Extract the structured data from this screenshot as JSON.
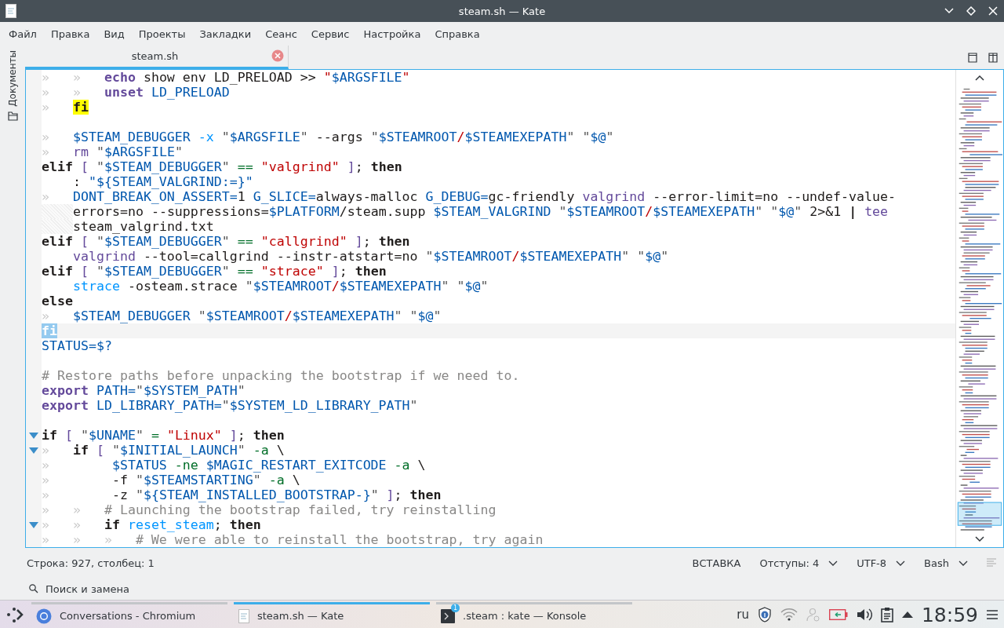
{
  "window": {
    "title": "steam.sh — Kate"
  },
  "menu": [
    "Файл",
    "Правка",
    "Вид",
    "Проекты",
    "Закладки",
    "Сеанс",
    "Сервис",
    "Настройка",
    "Справка"
  ],
  "sidebar": {
    "label": "Документы"
  },
  "tabs": [
    {
      "label": "steam.sh",
      "selected": true
    }
  ],
  "editor": {
    "lines": [
      {
        "kind": "code",
        "tokens": [
          {
            "kind": "ws",
            "text": "»   »   "
          },
          {
            "kind": "bi",
            "text": "echo"
          },
          {
            "kind": "plain",
            "text": " show env LD_PRELOAD >> "
          },
          {
            "kind": "str",
            "text": "\""
          },
          {
            "kind": "var",
            "text": "$ARGSFILE"
          },
          {
            "kind": "str",
            "text": "\""
          }
        ]
      },
      {
        "kind": "code",
        "tokens": [
          {
            "kind": "ws",
            "text": "»   »   "
          },
          {
            "kind": "bi",
            "text": "unset "
          },
          {
            "kind": "var",
            "text": "LD_PRELOAD"
          }
        ]
      },
      {
        "kind": "code",
        "tokens": [
          {
            "kind": "ws",
            "text": "»   "
          },
          {
            "kind": "match",
            "text": "fi"
          }
        ]
      },
      {
        "kind": "blank"
      },
      {
        "kind": "code",
        "tokens": [
          {
            "kind": "ws",
            "text": "»   "
          },
          {
            "kind": "var",
            "text": "$STEAM_DEBUGGER "
          },
          {
            "kind": "opt",
            "text": "-x "
          },
          {
            "kind": "q",
            "text": "\""
          },
          {
            "kind": "var",
            "text": "$ARGSFILE"
          },
          {
            "kind": "q",
            "text": "\""
          },
          {
            "kind": "plain",
            "text": " --args "
          },
          {
            "kind": "q",
            "text": "\""
          },
          {
            "kind": "var",
            "text": "$STEAMROOT"
          },
          {
            "kind": "sl",
            "text": "/"
          },
          {
            "kind": "var",
            "text": "$STEAMEXEPATH"
          },
          {
            "kind": "q",
            "text": "\" \""
          },
          {
            "kind": "var",
            "text": "$@"
          },
          {
            "kind": "q",
            "text": "\""
          }
        ]
      },
      {
        "kind": "code",
        "tokens": [
          {
            "kind": "ws",
            "text": "»   "
          },
          {
            "kind": "cmd",
            "text": "rm "
          },
          {
            "kind": "q",
            "text": "\""
          },
          {
            "kind": "var",
            "text": "$ARGSFILE"
          },
          {
            "kind": "q",
            "text": "\""
          }
        ]
      },
      {
        "kind": "code",
        "tokens": [
          {
            "kind": "kw",
            "text": "elif "
          },
          {
            "kind": "br",
            "text": "[ "
          },
          {
            "kind": "q",
            "text": "\""
          },
          {
            "kind": "var",
            "text": "$STEAM_DEBUGGER"
          },
          {
            "kind": "q",
            "text": "\" "
          },
          {
            "kind": "op",
            "text": "== "
          },
          {
            "kind": "str",
            "text": "\"valgrind\" "
          },
          {
            "kind": "br",
            "text": "]"
          },
          {
            "kind": "plain",
            "text": "; "
          },
          {
            "kind": "kw",
            "text": "then"
          }
        ]
      },
      {
        "kind": "code",
        "tokens": [
          {
            "kind": "plain",
            "text": "    : "
          },
          {
            "kind": "var",
            "text": "\"${STEAM_VALGRIND:=}\""
          }
        ]
      },
      {
        "kind": "code",
        "tokens": [
          {
            "kind": "ws",
            "text": "»   "
          },
          {
            "kind": "var",
            "text": "DONT_BREAK_ON_ASSERT="
          },
          {
            "kind": "plain",
            "text": "1 "
          },
          {
            "kind": "var",
            "text": "G_SLICE="
          },
          {
            "kind": "plain",
            "text": "always-malloc "
          },
          {
            "kind": "var",
            "text": "G_DEBUG="
          },
          {
            "kind": "plain",
            "text": "gc-friendly "
          },
          {
            "kind": "cmd",
            "text": "valgrind"
          },
          {
            "kind": "plain",
            "text": " --error-limit=no --undef-value-"
          }
        ]
      },
      {
        "kind": "wrapped",
        "tokens": [
          {
            "kind": "plain",
            "text": "errors=no --suppressions="
          },
          {
            "kind": "var",
            "text": "$PLATFORM"
          },
          {
            "kind": "plain",
            "text": "/steam.supp "
          },
          {
            "kind": "var",
            "text": "$STEAM_VALGRIND "
          },
          {
            "kind": "q",
            "text": "\""
          },
          {
            "kind": "var",
            "text": "$STEAMROOT"
          },
          {
            "kind": "sl",
            "text": "/"
          },
          {
            "kind": "var",
            "text": "$STEAMEXEPATH"
          },
          {
            "kind": "q",
            "text": "\" \""
          },
          {
            "kind": "var",
            "text": "$@"
          },
          {
            "kind": "q",
            "text": "\""
          },
          {
            "kind": "plain",
            "text": " 2>&1 "
          },
          {
            "kind": "kw",
            "text": "| "
          },
          {
            "kind": "cmd",
            "text": "tee"
          }
        ]
      },
      {
        "kind": "wrapped",
        "tokens": [
          {
            "kind": "plain",
            "text": "steam_valgrind.txt"
          }
        ]
      },
      {
        "kind": "code",
        "tokens": [
          {
            "kind": "kw",
            "text": "elif "
          },
          {
            "kind": "br",
            "text": "[ "
          },
          {
            "kind": "q",
            "text": "\""
          },
          {
            "kind": "var",
            "text": "$STEAM_DEBUGGER"
          },
          {
            "kind": "q",
            "text": "\" "
          },
          {
            "kind": "op",
            "text": "== "
          },
          {
            "kind": "str",
            "text": "\"callgrind\" "
          },
          {
            "kind": "br",
            "text": "]"
          },
          {
            "kind": "plain",
            "text": "; "
          },
          {
            "kind": "kw",
            "text": "then"
          }
        ]
      },
      {
        "kind": "code",
        "tokens": [
          {
            "kind": "cmd",
            "text": "    valgrind"
          },
          {
            "kind": "plain",
            "text": " --tool=callgrind --instr-atstart=no "
          },
          {
            "kind": "q",
            "text": "\""
          },
          {
            "kind": "var",
            "text": "$STEAMROOT"
          },
          {
            "kind": "sl",
            "text": "/"
          },
          {
            "kind": "var",
            "text": "$STEAMEXEPATH"
          },
          {
            "kind": "q",
            "text": "\" \""
          },
          {
            "kind": "var",
            "text": "$@"
          },
          {
            "kind": "q",
            "text": "\""
          }
        ]
      },
      {
        "kind": "code",
        "tokens": [
          {
            "kind": "kw",
            "text": "elif "
          },
          {
            "kind": "br",
            "text": "[ "
          },
          {
            "kind": "q",
            "text": "\""
          },
          {
            "kind": "var",
            "text": "$STEAM_DEBUGGER"
          },
          {
            "kind": "q",
            "text": "\" "
          },
          {
            "kind": "op",
            "text": "== "
          },
          {
            "kind": "str",
            "text": "\"strace\" "
          },
          {
            "kind": "br",
            "text": "]"
          },
          {
            "kind": "plain",
            "text": "; "
          },
          {
            "kind": "kw",
            "text": "then"
          }
        ]
      },
      {
        "kind": "code",
        "tokens": [
          {
            "kind": "opt",
            "text": "    strace"
          },
          {
            "kind": "plain",
            "text": " -osteam.strace "
          },
          {
            "kind": "q",
            "text": "\""
          },
          {
            "kind": "var",
            "text": "$STEAMROOT"
          },
          {
            "kind": "sl",
            "text": "/"
          },
          {
            "kind": "var",
            "text": "$STEAMEXEPATH"
          },
          {
            "kind": "q",
            "text": "\" \""
          },
          {
            "kind": "var",
            "text": "$@"
          },
          {
            "kind": "q",
            "text": "\""
          }
        ]
      },
      {
        "kind": "code",
        "tokens": [
          {
            "kind": "kw",
            "text": "else"
          }
        ]
      },
      {
        "kind": "code",
        "tokens": [
          {
            "kind": "ws",
            "text": "»   "
          },
          {
            "kind": "var",
            "text": "$STEAM_DEBUGGER "
          },
          {
            "kind": "q",
            "text": "\""
          },
          {
            "kind": "var",
            "text": "$STEAMROOT"
          },
          {
            "kind": "sl",
            "text": "/"
          },
          {
            "kind": "var",
            "text": "$STEAMEXEPATH"
          },
          {
            "kind": "q",
            "text": "\" \""
          },
          {
            "kind": "var",
            "text": "$@"
          },
          {
            "kind": "q",
            "text": "\""
          }
        ]
      },
      {
        "kind": "current",
        "tokens": [
          {
            "kind": "sel",
            "text": "fi"
          }
        ]
      },
      {
        "kind": "code",
        "tokens": [
          {
            "kind": "var",
            "text": "STATUS=$?"
          }
        ]
      },
      {
        "kind": "blank"
      },
      {
        "kind": "code",
        "tokens": [
          {
            "kind": "cmt",
            "text": "# Restore paths before unpacking the bootstrap if we need to."
          }
        ]
      },
      {
        "kind": "code",
        "tokens": [
          {
            "kind": "bi",
            "text": "export "
          },
          {
            "kind": "var",
            "text": "PATH="
          },
          {
            "kind": "q",
            "text": "\""
          },
          {
            "kind": "var",
            "text": "$SYSTEM_PATH"
          },
          {
            "kind": "q",
            "text": "\""
          }
        ]
      },
      {
        "kind": "code",
        "tokens": [
          {
            "kind": "bi",
            "text": "export "
          },
          {
            "kind": "var",
            "text": "LD_LIBRARY_PATH="
          },
          {
            "kind": "q",
            "text": "\""
          },
          {
            "kind": "var",
            "text": "$SYSTEM_LD_LIBRARY_PATH"
          },
          {
            "kind": "q",
            "text": "\""
          }
        ]
      },
      {
        "kind": "blank"
      },
      {
        "kind": "fold",
        "tokens": [
          {
            "kind": "kw",
            "text": "if "
          },
          {
            "kind": "br",
            "text": "[ "
          },
          {
            "kind": "q",
            "text": "\""
          },
          {
            "kind": "var",
            "text": "$UNAME"
          },
          {
            "kind": "q",
            "text": "\" "
          },
          {
            "kind": "op",
            "text": "= "
          },
          {
            "kind": "str",
            "text": "\"Linux\" "
          },
          {
            "kind": "br",
            "text": "]"
          },
          {
            "kind": "plain",
            "text": "; "
          },
          {
            "kind": "kw",
            "text": "then"
          }
        ]
      },
      {
        "kind": "fold",
        "tokens": [
          {
            "kind": "ws",
            "text": "»   "
          },
          {
            "kind": "kw",
            "text": "if "
          },
          {
            "kind": "br",
            "text": "[ "
          },
          {
            "kind": "q",
            "text": "\""
          },
          {
            "kind": "var",
            "text": "$INITIAL_LAUNCH"
          },
          {
            "kind": "q",
            "text": "\" "
          },
          {
            "kind": "op",
            "text": "-a"
          },
          {
            "kind": "plain",
            "text": " \\"
          }
        ]
      },
      {
        "kind": "code",
        "tokens": [
          {
            "kind": "ws",
            "text": "»        "
          },
          {
            "kind": "var",
            "text": "$STATUS "
          },
          {
            "kind": "op",
            "text": "-ne "
          },
          {
            "kind": "var",
            "text": "$MAGIC_RESTART_EXITCODE "
          },
          {
            "kind": "op",
            "text": "-a"
          },
          {
            "kind": "plain",
            "text": " \\"
          }
        ]
      },
      {
        "kind": "code",
        "tokens": [
          {
            "kind": "ws",
            "text": "»        "
          },
          {
            "kind": "plain",
            "text": "-f "
          },
          {
            "kind": "q",
            "text": "\""
          },
          {
            "kind": "var",
            "text": "$STEAMSTARTING"
          },
          {
            "kind": "q",
            "text": "\" "
          },
          {
            "kind": "op",
            "text": "-a"
          },
          {
            "kind": "plain",
            "text": " \\"
          }
        ]
      },
      {
        "kind": "code",
        "tokens": [
          {
            "kind": "ws",
            "text": "»        "
          },
          {
            "kind": "plain",
            "text": "-z "
          },
          {
            "kind": "q",
            "text": "\""
          },
          {
            "kind": "var",
            "text": "${STEAM_INSTALLED_BOOTSTRAP-}"
          },
          {
            "kind": "q",
            "text": "\" "
          },
          {
            "kind": "br",
            "text": "]"
          },
          {
            "kind": "plain",
            "text": "; "
          },
          {
            "kind": "kw",
            "text": "then"
          }
        ]
      },
      {
        "kind": "code",
        "tokens": [
          {
            "kind": "ws",
            "text": "»   »   "
          },
          {
            "kind": "cmt",
            "text": "# Launching the bootstrap failed, try reinstalling"
          }
        ]
      },
      {
        "kind": "fold",
        "tokens": [
          {
            "kind": "ws",
            "text": "»   »   "
          },
          {
            "kind": "kw",
            "text": "if "
          },
          {
            "kind": "opt",
            "text": "reset_steam"
          },
          {
            "kind": "plain",
            "text": "; "
          },
          {
            "kind": "kw",
            "text": "then"
          }
        ]
      },
      {
        "kind": "code",
        "tokens": [
          {
            "kind": "ws",
            "text": "»   »   »   "
          },
          {
            "kind": "cmt",
            "text": "# We were able to reinstall the bootstrap, try again"
          }
        ]
      }
    ]
  },
  "status_bar": {
    "position": "Строка: 927, столбец: 1",
    "mode": "ВСТАВКА",
    "indent": "Отступы: 4",
    "encoding": "UTF-8",
    "syntax": "Bash"
  },
  "search_bar": {
    "label": "Поиск и замена"
  },
  "taskbar": {
    "tasks": [
      {
        "kind": "browser",
        "label": "Conversations - Chromium",
        "selected": false
      },
      {
        "kind": "editor",
        "label": "steam.sh  — Kate",
        "selected": true
      },
      {
        "kind": "terminal",
        "label": ".steam : kate — Konsole",
        "selected": false,
        "badge": "1"
      }
    ],
    "layout": "ru",
    "clock": "18:59"
  }
}
